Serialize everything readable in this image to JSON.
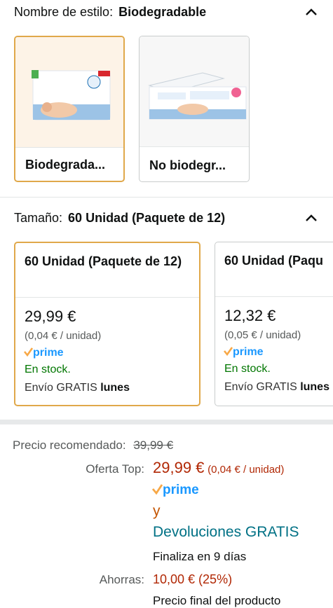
{
  "style_section": {
    "label": "Nombre de estilo:",
    "value": "Biodegradable",
    "options": [
      {
        "caption": "Biodegrada...",
        "selected": true,
        "image": "waterwipes-pack-icon"
      },
      {
        "caption": "No biodegr...",
        "selected": false,
        "image": "waterwipes-box-icon"
      }
    ]
  },
  "size_section": {
    "label": "Tamaño:",
    "value": "60 Unidad (Paquete de 12)",
    "options": [
      {
        "title": "60 Unidad (Paquete de 12)",
        "price": "29,99 €",
        "unit_price": "(0,04 € / unidad)",
        "prime": "prime",
        "stock": "En stock.",
        "shipping": "Envío GRATIS",
        "shipping_day": "lunes",
        "selected": true
      },
      {
        "title": "60 Unidad (Paqu",
        "price": "12,32 €",
        "unit_price": "(0,05 € / unidad)",
        "prime": "prime",
        "stock": "En stock.",
        "shipping": "Envío GRATIS",
        "shipping_day": "lunes",
        "selected": false
      }
    ]
  },
  "pricing": {
    "rrp_label": "Precio recomendado:",
    "rrp_value": "39,99 €",
    "deal_label": "Oferta Top:",
    "deal_price": "29,99 €",
    "deal_unit": "(0,04 € / unidad)",
    "prime": "prime",
    "and": "y",
    "returns": "Devoluciones GRATIS",
    "ends": "Finaliza en 9 días",
    "savings_label": "Ahorras:",
    "savings_value": "10,00 € (25%)",
    "final_price_note": "Precio final del producto"
  },
  "colors": {
    "selected_border": "#e0a84a",
    "deal_red": "#b12704",
    "stock_green": "#007600",
    "link_teal": "#007185",
    "prime_blue": "#1a98ff",
    "prime_check": "#f7a847"
  }
}
